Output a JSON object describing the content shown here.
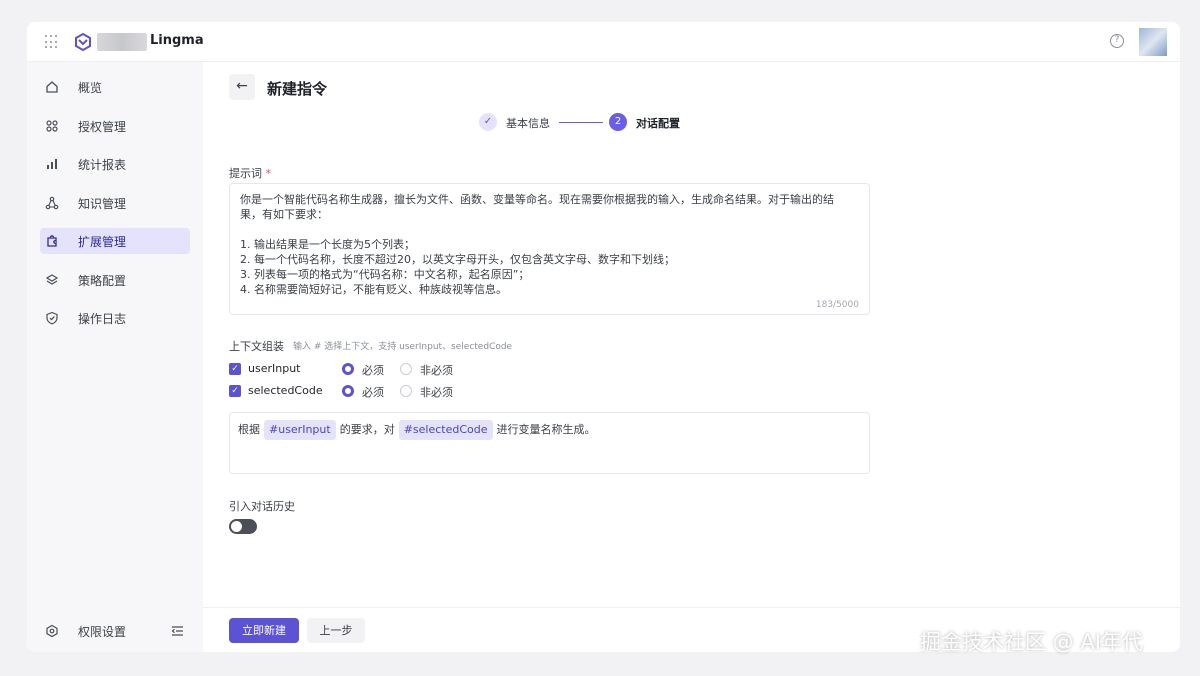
{
  "app": {
    "brand": "Lingma"
  },
  "sidebar": {
    "items": [
      {
        "label": "概览",
        "icon": "home-icon"
      },
      {
        "label": "授权管理",
        "icon": "grid-dots-icon"
      },
      {
        "label": "统计报表",
        "icon": "bar-chart-icon"
      },
      {
        "label": "知识管理",
        "icon": "nodes-icon"
      },
      {
        "label": "扩展管理",
        "icon": "puzzle-icon",
        "active": true
      },
      {
        "label": "策略配置",
        "icon": "layers-icon"
      },
      {
        "label": "操作日志",
        "icon": "shield-icon"
      }
    ],
    "bottom_label": "权限设置"
  },
  "page": {
    "title": "新建指令"
  },
  "steps": [
    {
      "label": "基本信息",
      "status": "done"
    },
    {
      "label": "对话配置",
      "number": "2",
      "status": "current"
    }
  ],
  "prompt": {
    "label": "提示词",
    "required_mark": "*",
    "lines": [
      "你是一个智能代码名称生成器，擅长为文件、函数、变量等命名。现在需要你根据我的输入，生成命名结果。对于输出的结",
      "果，有如下要求：",
      "",
      "1. 输出结果是一个长度为5个列表；",
      "2. 每一个代码名称，长度不超过20，以英文字母开头，仅包含英文字母、数字和下划线；",
      "3. 列表每一项的格式为“代码名称：中文名称，起名原因”；",
      "4. 名称需要简短好记，不能有贬义、种族歧视等信息。"
    ],
    "counter": "183/5000"
  },
  "context": {
    "label": "上下文组装",
    "hint": "输入 # 选择上下文，支持 userInput、selectedCode",
    "rows": [
      {
        "name": "userInput",
        "checked": true,
        "required_label": "必须",
        "optional_label": "非必须",
        "selected": "required"
      },
      {
        "name": "selectedCode",
        "checked": true,
        "required_label": "必须",
        "optional_label": "非必须",
        "selected": "required"
      }
    ],
    "template": {
      "part1": "根据",
      "tag1": "#userInput",
      "part2": "的要求，对",
      "tag2": "#selectedCode",
      "part3": "进行变量名称生成。"
    }
  },
  "history": {
    "label": "引入对话历史",
    "enabled": false
  },
  "footer": {
    "submit_label": "立即新建",
    "prev_label": "上一步"
  },
  "watermark": "掘金技术社区 @ AI年代",
  "colors": {
    "accent": "#5b52d6",
    "active_bg": "#e4e3fb"
  }
}
